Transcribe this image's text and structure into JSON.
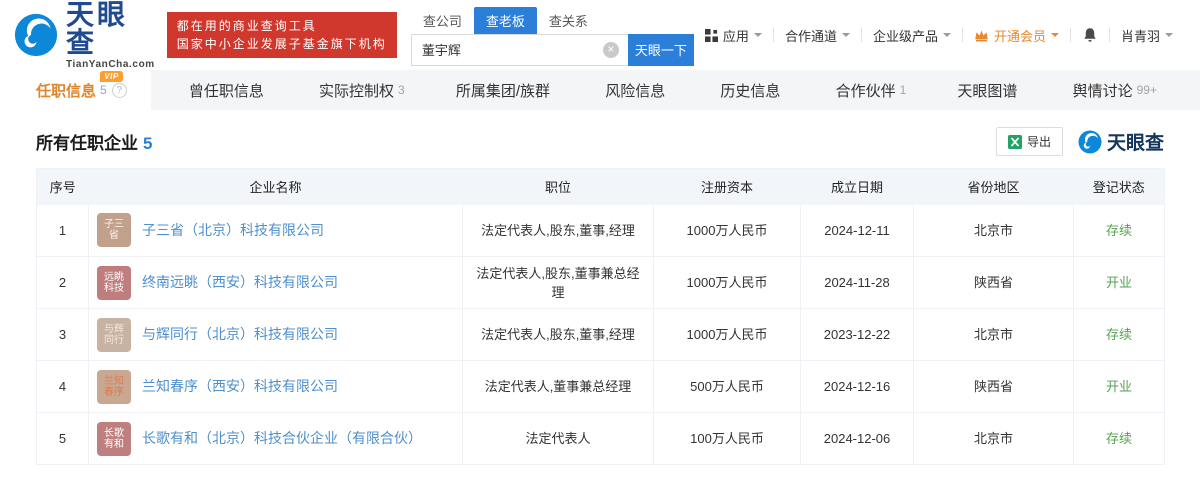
{
  "header": {
    "logo": {
      "name": "天眼查",
      "domain": "TianYanCha.com"
    },
    "promo_badge": {
      "line1": "都在用的商业查询工具",
      "line2": "国家中小企业发展子基金旗下机构"
    },
    "search": {
      "tabs": [
        {
          "label": "查公司",
          "active": false
        },
        {
          "label": "查老板",
          "active": true
        },
        {
          "label": "查关系",
          "active": false
        }
      ],
      "value": "董宇辉",
      "button": "天眼一下"
    },
    "menu": {
      "apps": "应用",
      "partner": "合作通道",
      "enterprise": "企业级产品",
      "vip": "开通会员",
      "user": "肖青羽"
    }
  },
  "nav": {
    "vip_badge_text": "VIP",
    "help_glyph": "?",
    "items": [
      {
        "label": "任职信息",
        "count": "5",
        "active": true,
        "vip": true,
        "help": true
      },
      {
        "label": "曾任职信息",
        "count": "",
        "active": false,
        "vip": false,
        "help": false
      },
      {
        "label": "实际控制权",
        "count": "3",
        "active": false,
        "vip": false,
        "help": false
      },
      {
        "label": "所属集团/族群",
        "count": "",
        "active": false,
        "vip": false,
        "help": false
      },
      {
        "label": "风险信息",
        "count": "",
        "active": false,
        "vip": false,
        "help": false
      },
      {
        "label": "历史信息",
        "count": "",
        "active": false,
        "vip": false,
        "help": false
      },
      {
        "label": "合作伙伴",
        "count": "1",
        "active": false,
        "vip": false,
        "help": false
      },
      {
        "label": "天眼图谱",
        "count": "",
        "active": false,
        "vip": false,
        "help": false
      },
      {
        "label": "舆情讨论",
        "count": "99+",
        "active": false,
        "vip": false,
        "help": false
      }
    ]
  },
  "section": {
    "title": "所有任职企业",
    "count": "5",
    "export_label": "导出",
    "watermark": "天眼查"
  },
  "table": {
    "headers": [
      "序号",
      "企业名称",
      "职位",
      "注册资本",
      "成立日期",
      "省份地区",
      "登记状态"
    ],
    "rows": [
      {
        "no": "1",
        "icon_lines": [
          "子三",
          "省"
        ],
        "icon_bg": "#c2a18c",
        "icon_fg": "#fdf3ec",
        "name": "子三省（北京）科技有限公司",
        "position": "法定代表人,股东,董事,经理",
        "capital": "1000万人民币",
        "date": "2024-12-11",
        "region": "北京市",
        "status": "存续"
      },
      {
        "no": "2",
        "icon_lines": [
          "远眺",
          "科技"
        ],
        "icon_bg": "#c07d7d",
        "icon_fg": "#ffffff",
        "name": "终南远眺（西安）科技有限公司",
        "position": "法定代表人,股东,董事兼总经理",
        "capital": "1000万人民币",
        "date": "2024-11-28",
        "region": "陕西省",
        "status": "开业"
      },
      {
        "no": "3",
        "icon_lines": [
          "与辉",
          "同行"
        ],
        "icon_bg": "#c8b2a2",
        "icon_fg": "#f4e9de",
        "name": "与辉同行（北京）科技有限公司",
        "position": "法定代表人,股东,董事,经理",
        "capital": "1000万人民币",
        "date": "2023-12-22",
        "region": "北京市",
        "status": "存续"
      },
      {
        "no": "4",
        "icon_lines": [
          "兰知",
          "春序"
        ],
        "icon_bg": "#c9a892",
        "icon_fg": "#e2784f",
        "name": "兰知春序（西安）科技有限公司",
        "position": "法定代表人,董事兼总经理",
        "capital": "500万人民币",
        "date": "2024-12-16",
        "region": "陕西省",
        "status": "开业"
      },
      {
        "no": "5",
        "icon_lines": [
          "长歌",
          "有和"
        ],
        "icon_bg": "#bf7f7f",
        "icon_fg": "#ffffff",
        "name": "长歌有和（北京）科技合伙企业（有限合伙）",
        "position": "法定代表人",
        "capital": "100万人民币",
        "date": "2024-12-06",
        "region": "北京市",
        "status": "存续"
      }
    ]
  },
  "colors": {
    "brand_blue": "#0d87d8",
    "primary_button": "#2b7fd9",
    "link": "#4e8fcd",
    "active_tab_orange": "#e2862e",
    "member_orange": "#e8882f",
    "status_green": "#55a155",
    "promo_red": "#d0382e"
  }
}
